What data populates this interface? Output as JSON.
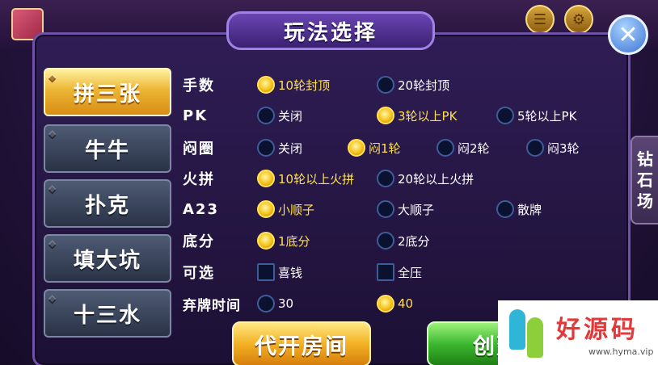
{
  "dialog": {
    "title": "玩法选择",
    "close_icon": "close-icon"
  },
  "side_tabs": [
    {
      "label": "拼三张",
      "active": true
    },
    {
      "label": "牛牛",
      "active": false
    },
    {
      "label": "扑克",
      "active": false
    },
    {
      "label": "填大坑",
      "active": false
    },
    {
      "label": "十三水",
      "active": false
    }
  ],
  "rows": [
    {
      "label": "手数",
      "options": [
        {
          "text": "10轮封顶",
          "selected": true
        },
        {
          "text": "20轮封顶",
          "selected": false
        }
      ]
    },
    {
      "label": "PK",
      "options": [
        {
          "text": "关闭",
          "selected": false
        },
        {
          "text": "3轮以上PK",
          "selected": true
        },
        {
          "text": "5轮以上PK",
          "selected": false
        }
      ]
    },
    {
      "label": "闷圈",
      "options": [
        {
          "text": "关闭",
          "selected": false
        },
        {
          "text": "闷1轮",
          "selected": true
        },
        {
          "text": "闷2轮",
          "selected": false
        },
        {
          "text": "闷3轮",
          "selected": false
        }
      ]
    },
    {
      "label": "火拼",
      "options": [
        {
          "text": "10轮以上火拼",
          "selected": true
        },
        {
          "text": "20轮以上火拼",
          "selected": false
        }
      ]
    },
    {
      "label": "A23",
      "options": [
        {
          "text": "小顺子",
          "selected": true
        },
        {
          "text": "大顺子",
          "selected": false
        },
        {
          "text": "散牌",
          "selected": false
        }
      ]
    },
    {
      "label": "底分",
      "options": [
        {
          "text": "1底分",
          "selected": true
        },
        {
          "text": "2底分",
          "selected": false
        }
      ]
    },
    {
      "label": "可选",
      "options": [
        {
          "text": "喜钱",
          "checked": false
        },
        {
          "text": "全压",
          "checked": false
        }
      ]
    },
    {
      "label": "弃牌时间",
      "options": [
        {
          "text": "30",
          "selected": false
        },
        {
          "text": "40",
          "selected": true
        }
      ]
    }
  ],
  "right_tab": {
    "chars": [
      "钻",
      "石",
      "场"
    ]
  },
  "buttons": {
    "proxy_open": "代开房间",
    "create": "创建"
  },
  "watermark": {
    "title": "好源码",
    "url": "www.hyma.vip"
  },
  "colors": {
    "selected_text": "#ffe04a",
    "active_tab": "#ecb533"
  }
}
